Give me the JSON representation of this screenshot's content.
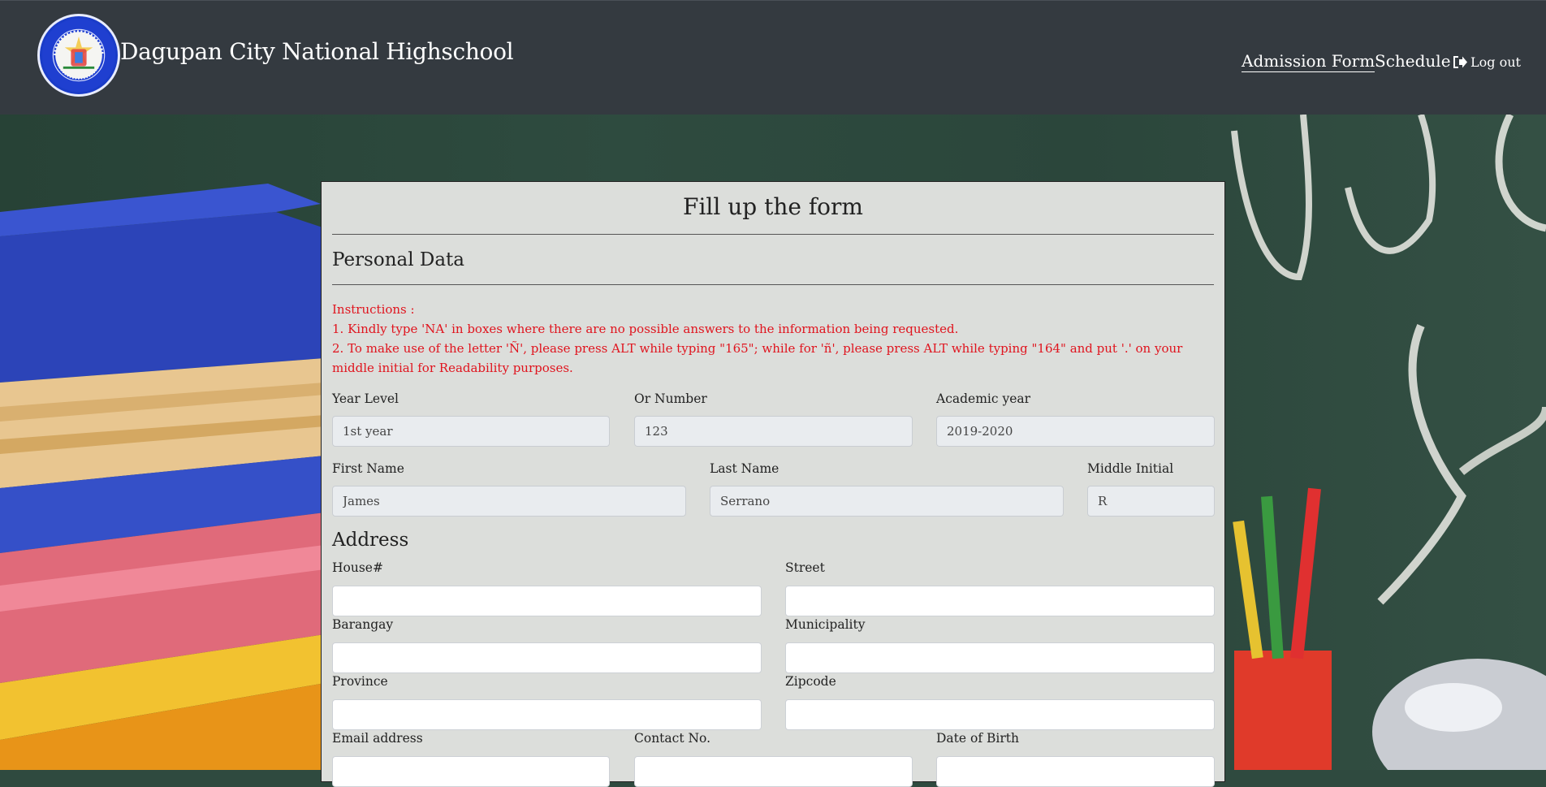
{
  "header": {
    "school_name": "Dagupan City National Highschool",
    "logo_ring_text": "DAGUPAN CITY NATIONAL HIGH SCHOOL",
    "logo_bottom_text": "Tapuac District, Dagupan City",
    "nav": {
      "admission": "Admission Form",
      "schedule": "Schedule",
      "logout": "Log out"
    }
  },
  "form": {
    "title": "Fill up the form",
    "section_personal": "Personal Data",
    "instructions": {
      "heading": "Instructions :",
      "line1": "1. Kindly type 'NA' in boxes where there are no possible answers to the information being requested.",
      "line2": "2. To make use of the letter 'Ñ', please press ALT while typing \"165\"; while for 'ñ', please press ALT while typing \"164\" and put '.' on your middle initial for Readability purposes."
    },
    "fields": {
      "year_level": {
        "label": "Year Level",
        "value": "1st year"
      },
      "or_number": {
        "label": "Or Number",
        "value": "123"
      },
      "academic_year": {
        "label": "Academic year",
        "value": "2019-2020"
      },
      "first_name": {
        "label": "First Name",
        "value": "James"
      },
      "last_name": {
        "label": "Last Name",
        "value": "Serrano"
      },
      "middle_initial": {
        "label": "Middle Initial",
        "value": "R"
      }
    },
    "section_address": "Address",
    "address": {
      "house": {
        "label": "House#",
        "value": ""
      },
      "street": {
        "label": "Street",
        "value": ""
      },
      "barangay": {
        "label": "Barangay",
        "value": ""
      },
      "municipality": {
        "label": "Municipality",
        "value": ""
      },
      "province": {
        "label": "Province",
        "value": ""
      },
      "zipcode": {
        "label": "Zipcode",
        "value": ""
      }
    },
    "contact": {
      "email": {
        "label": "Email address",
        "value": ""
      },
      "contact_no": {
        "label": "Contact No.",
        "value": ""
      },
      "dob": {
        "label": "Date of Birth",
        "value": ""
      }
    }
  },
  "colors": {
    "navbar": "#343a40",
    "card": "#dcdedb",
    "instructions_red": "#e0141e",
    "readonly_field": "#e9ecef"
  },
  "icons": {
    "logout": "sign-out-icon"
  }
}
